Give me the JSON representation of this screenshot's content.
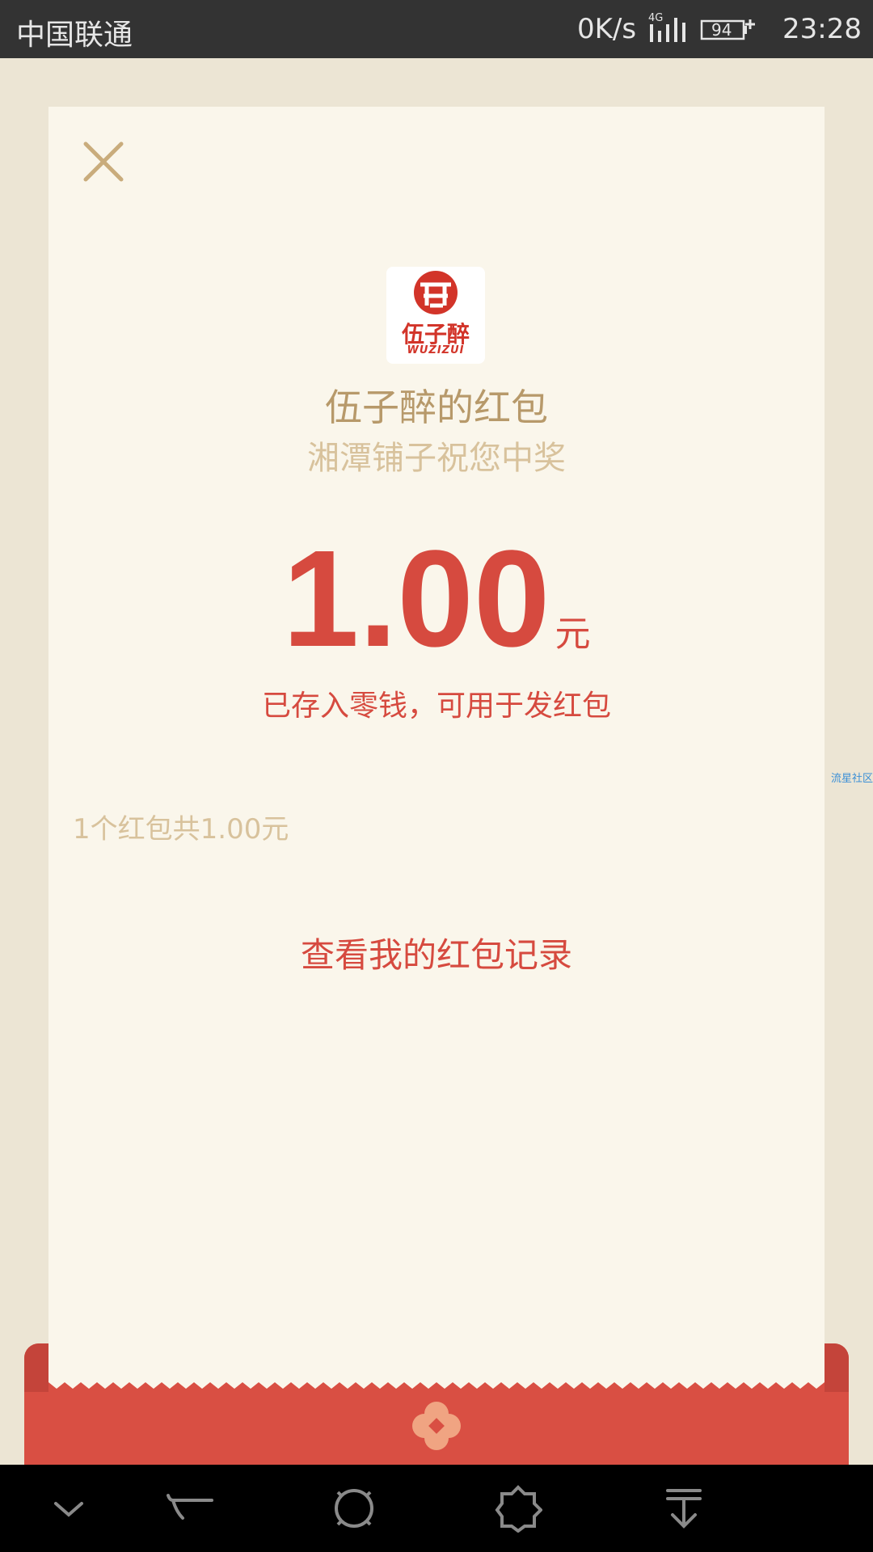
{
  "status_bar": {
    "carrier": "中国联通",
    "net_speed": "0K/s",
    "network_type": "4G",
    "battery": "94",
    "time": "23:28"
  },
  "card": {
    "logo": {
      "name": "伍子醉",
      "latin": "WUZIZUI"
    },
    "sender_title": "伍子醉的红包",
    "greeting": "湘潭铺子祝您中奖",
    "amount": "1.00",
    "unit": "元",
    "deposit_note": "已存入零钱，可用于发红包",
    "summary": "1个红包共1.00元",
    "history_link": "查看我的红包记录"
  },
  "watermark": "流星社区",
  "colors": {
    "accent_red": "#d64a3f",
    "gold": "#b7996a",
    "light_gold": "#d8c29c",
    "card_bg": "#faf6eb",
    "page_bg": "#ece5d4"
  },
  "nav_bar": {
    "icons": [
      "chevron-down-icon",
      "back-icon",
      "home-icon",
      "recents-icon",
      "notification-pull-icon"
    ]
  }
}
